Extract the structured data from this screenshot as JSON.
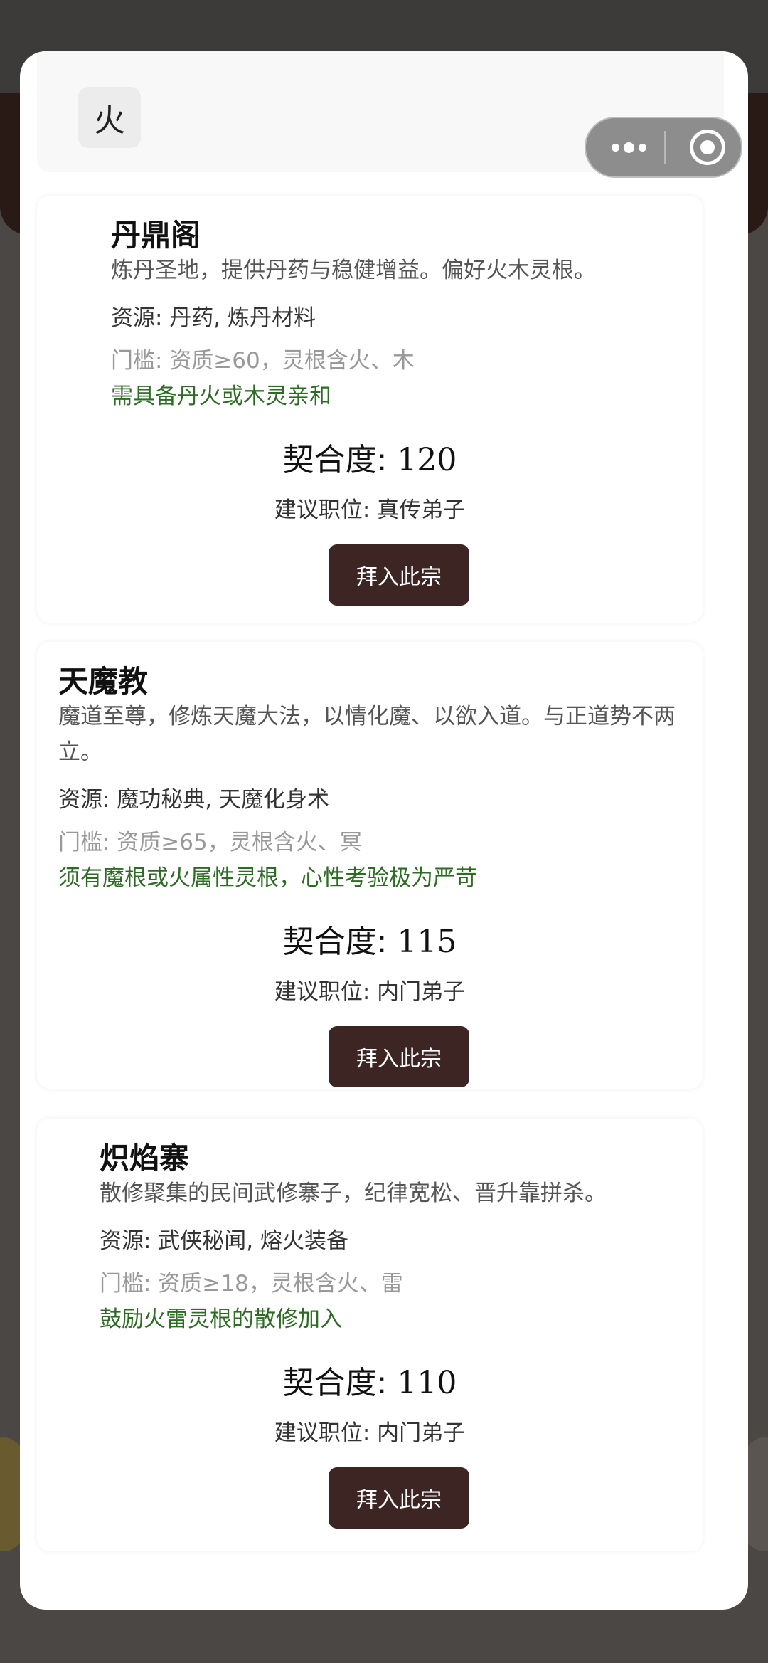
{
  "header": {
    "element_chip": "火"
  },
  "sects": [
    {
      "name": "丹鼎阁",
      "description": "炼丹圣地，提供丹药与稳健增益。偏好火木灵根。",
      "resources": "资源: 丹药, 炼丹材料",
      "threshold": "门槛: 资质≥60，灵根含火、木",
      "note": "需具备丹火或木灵亲和",
      "score_label": "契合度: ",
      "score": "120",
      "position": "建议职位: 真传弟子",
      "join_label": "拜入此宗"
    },
    {
      "name": "天魔教",
      "description": "魔道至尊，修炼天魔大法，以情化魔、以欲入道。与正道势不两立。",
      "resources": "资源: 魔功秘典, 天魔化身术",
      "threshold": "门槛: 资质≥65，灵根含火、冥",
      "note": "须有魔根或火属性灵根，心性考验极为严苛",
      "score_label": "契合度: ",
      "score": "115",
      "position": "建议职位: 内门弟子",
      "join_label": "拜入此宗"
    },
    {
      "name": "炽焰寨",
      "description": "散修聚集的民间武修寨子，纪律宽松、晋升靠拼杀。",
      "resources": "资源: 武侠秘闻, 熔火装备",
      "threshold": "门槛: 资质≥18，灵根含火、雷",
      "note": "鼓励火雷灵根的散修加入",
      "score_label": "契合度: ",
      "score": "110",
      "position": "建议职位: 内门弟子",
      "join_label": "拜入此宗"
    }
  ]
}
